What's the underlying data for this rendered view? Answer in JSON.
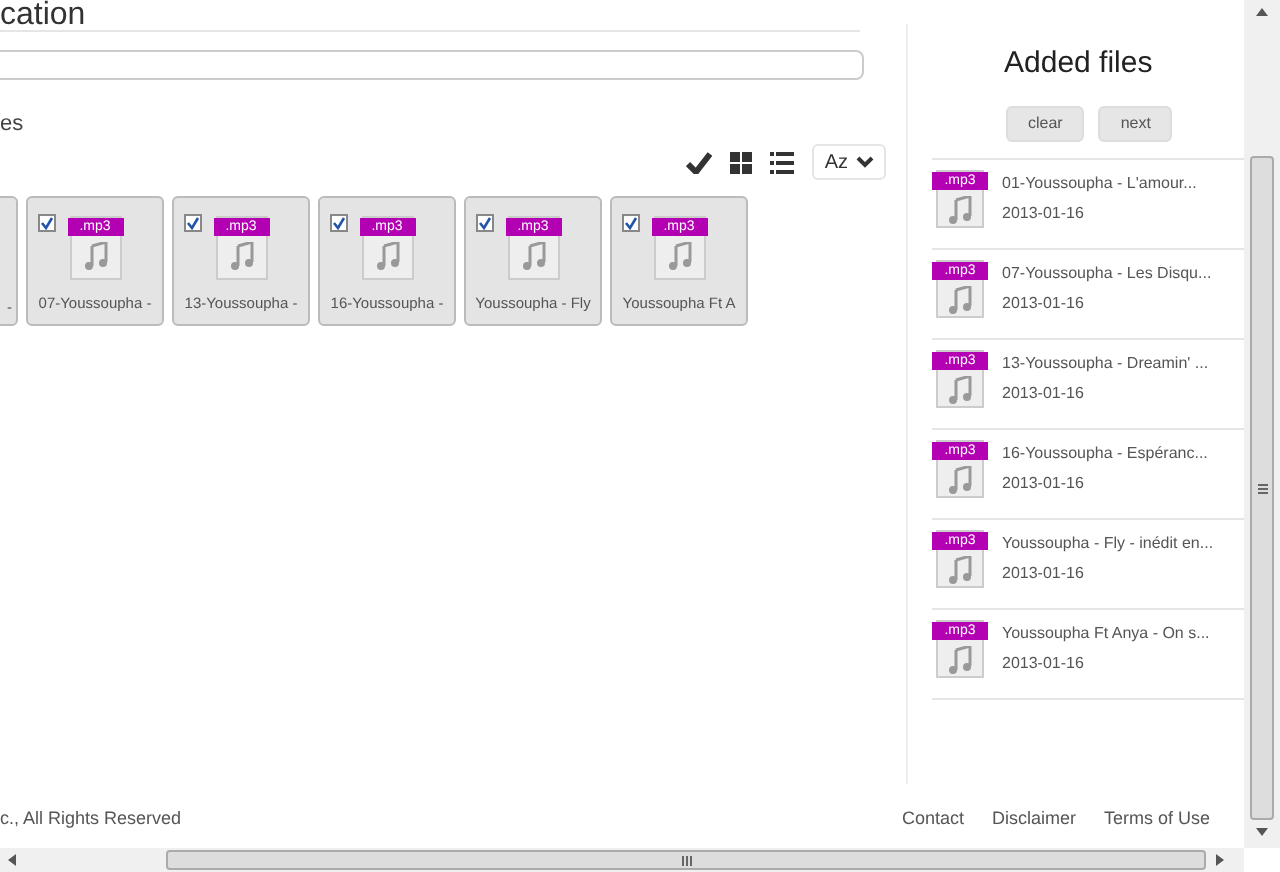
{
  "page": {
    "title": "cation",
    "section_label": "es"
  },
  "toolbar": {
    "sort_label": "Az"
  },
  "tiles": [
    {
      "label": "-"
    },
    {
      "label": "07-Youssoupha -",
      "checked": true,
      "badge": ".mp3"
    },
    {
      "label": "13-Youssoupha -",
      "checked": true,
      "badge": ".mp3"
    },
    {
      "label": "16-Youssoupha -",
      "checked": true,
      "badge": ".mp3"
    },
    {
      "label": "Youssoupha - Fly",
      "checked": true,
      "badge": ".mp3"
    },
    {
      "label": "Youssoupha Ft A",
      "checked": true,
      "badge": ".mp3"
    }
  ],
  "sidebar": {
    "title": "Added files",
    "buttons": [
      "clear",
      "next"
    ],
    "files": [
      {
        "name": "01-Youssoupha - L'amour...",
        "date": "2013-01-16",
        "badge": ".mp3"
      },
      {
        "name": "07-Youssoupha - Les Disqu...",
        "date": "2013-01-16",
        "badge": ".mp3"
      },
      {
        "name": "13-Youssoupha - Dreamin' ...",
        "date": "2013-01-16",
        "badge": ".mp3"
      },
      {
        "name": "16-Youssoupha - Espéranc...",
        "date": "2013-01-16",
        "badge": ".mp3"
      },
      {
        "name": "Youssoupha - Fly - inédit en...",
        "date": "2013-01-16",
        "badge": ".mp3"
      },
      {
        "name": "Youssoupha Ft Anya - On s...",
        "date": "2013-01-16",
        "badge": ".mp3"
      }
    ]
  },
  "footer": {
    "copyright": "c., All Rights Reserved",
    "links": [
      "Contact",
      "Disclaimer",
      "Terms of Use"
    ]
  }
}
